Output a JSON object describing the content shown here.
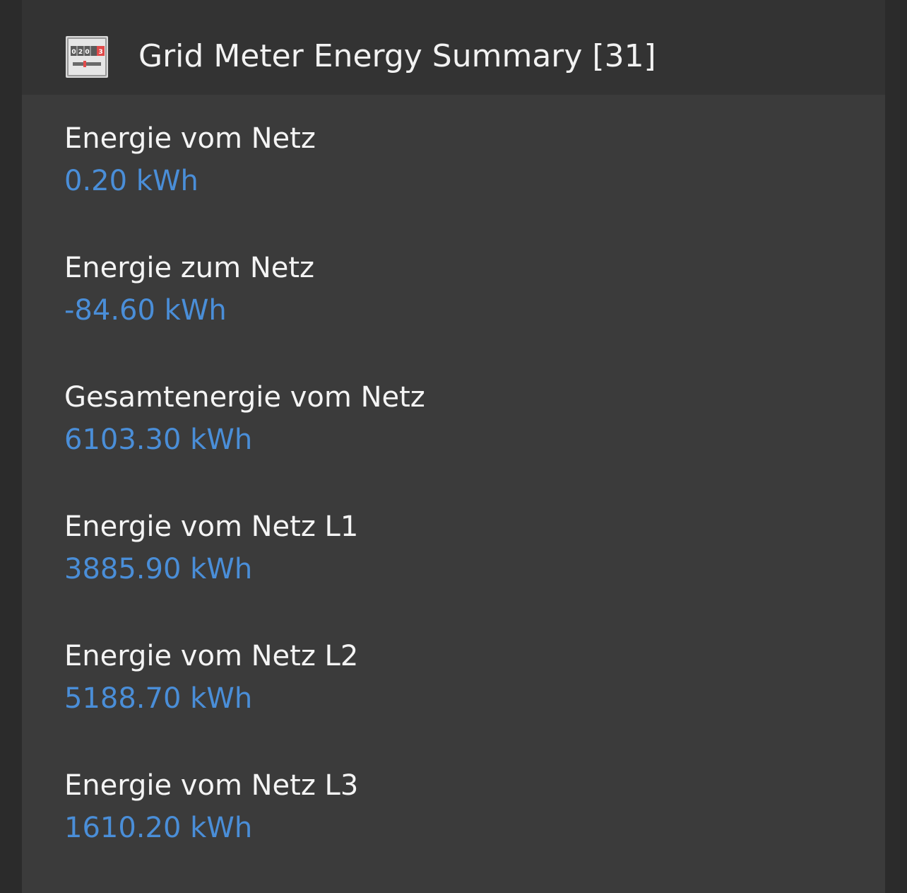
{
  "header": {
    "icon": "meter-icon",
    "title": "Grid Meter Energy Summary [31]",
    "icon_digits": [
      "0",
      "2",
      "0",
      "3"
    ]
  },
  "items": [
    {
      "label": "Energie vom Netz",
      "value": "0.20 kWh"
    },
    {
      "label": "Energie zum Netz",
      "value": "-84.60 kWh"
    },
    {
      "label": "Gesamtenergie vom Netz",
      "value": "6103.30 kWh"
    },
    {
      "label": "Energie vom Netz L1",
      "value": "3885.90 kWh"
    },
    {
      "label": "Energie vom Netz L2",
      "value": "5188.70 kWh"
    },
    {
      "label": "Energie vom Netz L3",
      "value": "1610.20 kWh"
    }
  ],
  "colors": {
    "background": "#2b2b2b",
    "card": "#3b3b3b",
    "header": "#333333",
    "label": "#f4f4f4",
    "value": "#4a8ed8",
    "meter_accent": "#e04a4a"
  }
}
